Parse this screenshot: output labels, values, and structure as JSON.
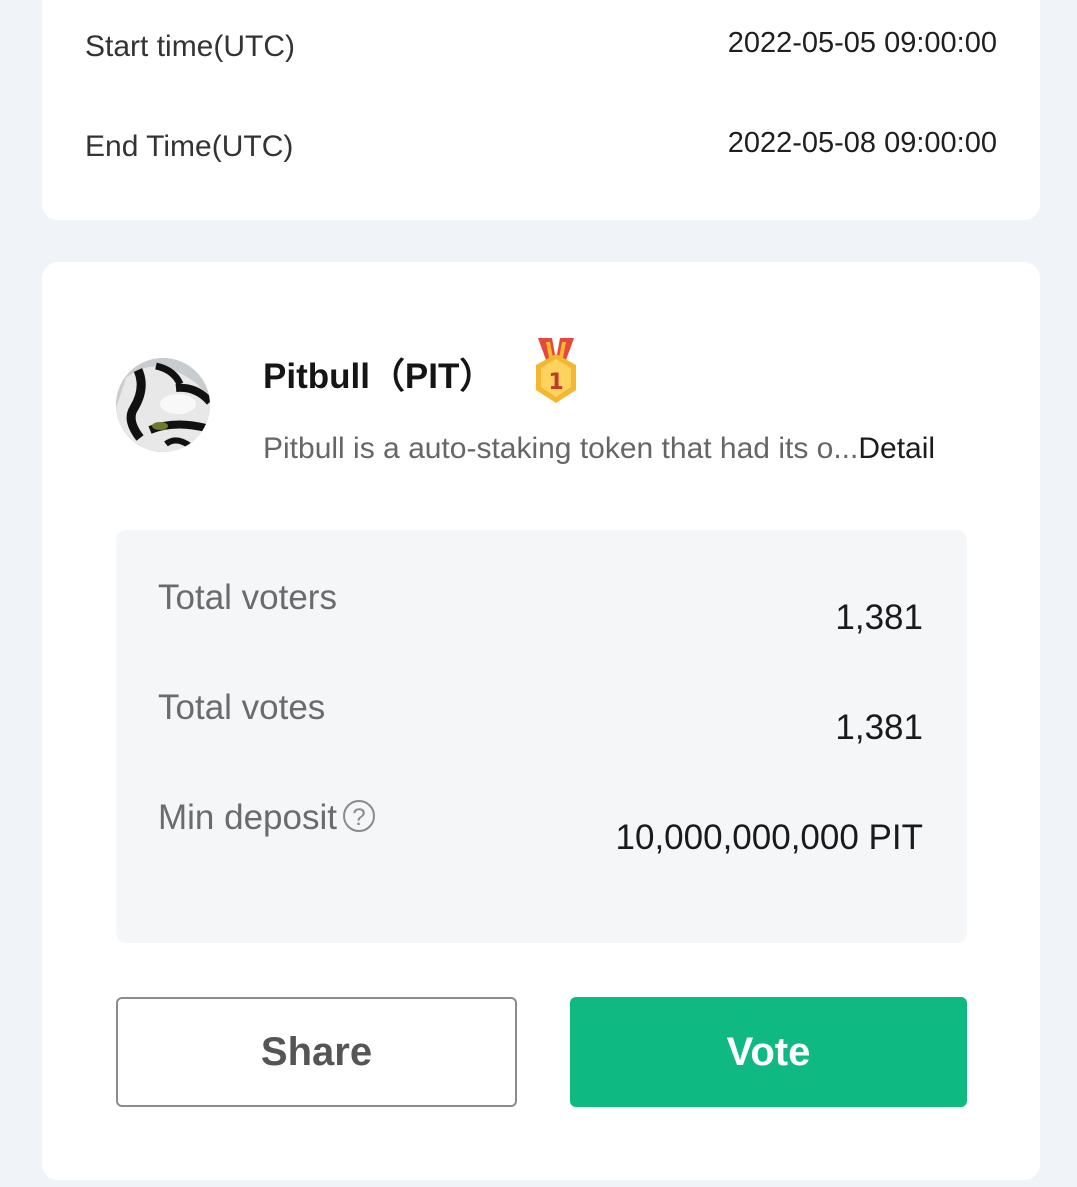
{
  "schedule": {
    "start": {
      "label": "Start time(UTC)",
      "value": "2022-05-05 09:00:00"
    },
    "end": {
      "label": "End Time(UTC)",
      "value": "2022-05-08 09:00:00"
    }
  },
  "token": {
    "name": "Pitbull（PIT）",
    "rank": "1",
    "description": "Pitbull is a auto-staking token that had its o...",
    "detail_link": "Detail",
    "avatar_icon": "pitbull-avatar",
    "medal_icon": "gold-medal-icon"
  },
  "stats": {
    "voters": {
      "label": "Total voters",
      "value": "1,381"
    },
    "votes": {
      "label": "Total votes",
      "value": "1,381"
    },
    "deposit": {
      "label": "Min deposit",
      "help": "?",
      "value": "10,000,000,000 PIT"
    }
  },
  "actions": {
    "share_label": "Share",
    "vote_label": "Vote"
  },
  "colors": {
    "accent": "#0fba82",
    "background": "#f0f4f9",
    "medal_gold": "#f5b731",
    "medal_ribbon": "#e8473b"
  }
}
